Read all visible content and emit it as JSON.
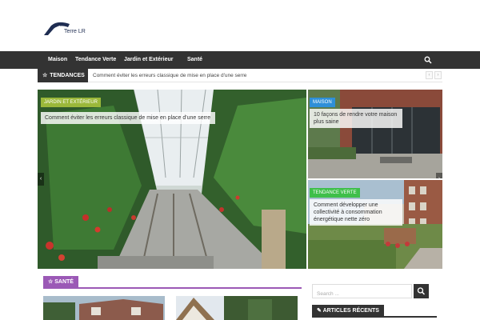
{
  "site": {
    "logo_text": "Terre LR"
  },
  "nav": {
    "items": [
      {
        "label": "Maison"
      },
      {
        "label": "Tendance Verte"
      },
      {
        "label": "Jardin et Extérieur"
      },
      {
        "label": "Santé"
      }
    ],
    "search_icon": "search-icon"
  },
  "ticker": {
    "label": "TENDANCES",
    "headline": "Comment éviter les erreurs classique de mise en place d'une serre",
    "prev": "‹",
    "next": "›"
  },
  "slider": {
    "main": {
      "category": "JARDIN ET EXTÉRIEUR",
      "title": "Comment éviter les erreurs classique de mise en place d'une serre"
    },
    "top": {
      "category": "MAISON",
      "title": "10 façons de rendre votre maison plus saine"
    },
    "bottom": {
      "category": "TENDANCE VERTE",
      "title": "Comment développer une collectivité à consommation énergétique nette zéro"
    },
    "prev": "‹",
    "next": "›"
  },
  "section": {
    "label": "SANTÉ"
  },
  "sidebar": {
    "search_placeholder": "Search ...",
    "recent_label": "ARTICLES RÉCENTS"
  },
  "colors": {
    "nav_bg": "#333333",
    "jardin": "#9bb83a",
    "maison": "#2f8fd8",
    "tendance": "#3fbf4a",
    "sante": "#9b59b6"
  }
}
